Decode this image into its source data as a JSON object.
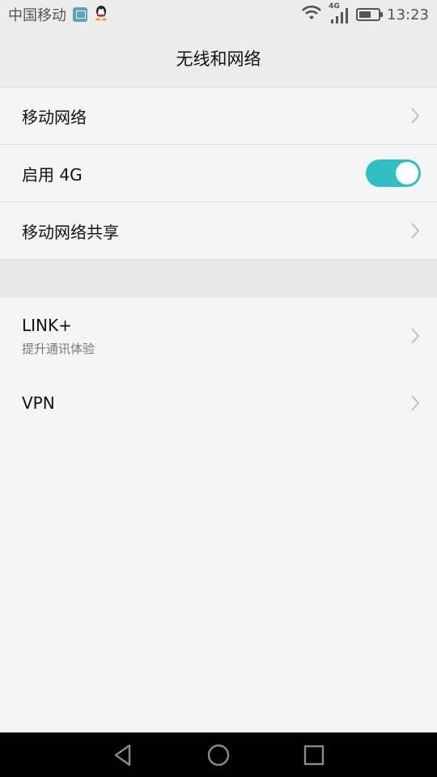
{
  "status_bar": {
    "carrier": "中国移动",
    "network_type": "4G",
    "time": "13:23",
    "battery_level": 0.55,
    "icons": [
      "gallery-notification-icon",
      "qq-icon",
      "wifi-icon",
      "cellular-signal-icon",
      "battery-icon"
    ]
  },
  "header": {
    "title": "无线和网络"
  },
  "section1": {
    "items": [
      {
        "label": "移动网络",
        "icon": "chevron-right-icon"
      },
      {
        "label": "启用 4G",
        "toggle": true
      },
      {
        "label": "移动网络共享",
        "icon": "chevron-right-icon"
      }
    ]
  },
  "section2": {
    "items": [
      {
        "label": "LINK+",
        "sublabel": "提升通讯体验",
        "icon": "chevron-right-icon"
      },
      {
        "label": "VPN",
        "icon": "chevron-right-icon"
      }
    ]
  },
  "nav_bar": {
    "icons": [
      "back-icon",
      "home-icon",
      "recents-icon"
    ]
  },
  "colors": {
    "accent": "#30bfc2",
    "background": "#f5f5f5",
    "header_background": "#ececec",
    "nav_background": "#000000"
  }
}
